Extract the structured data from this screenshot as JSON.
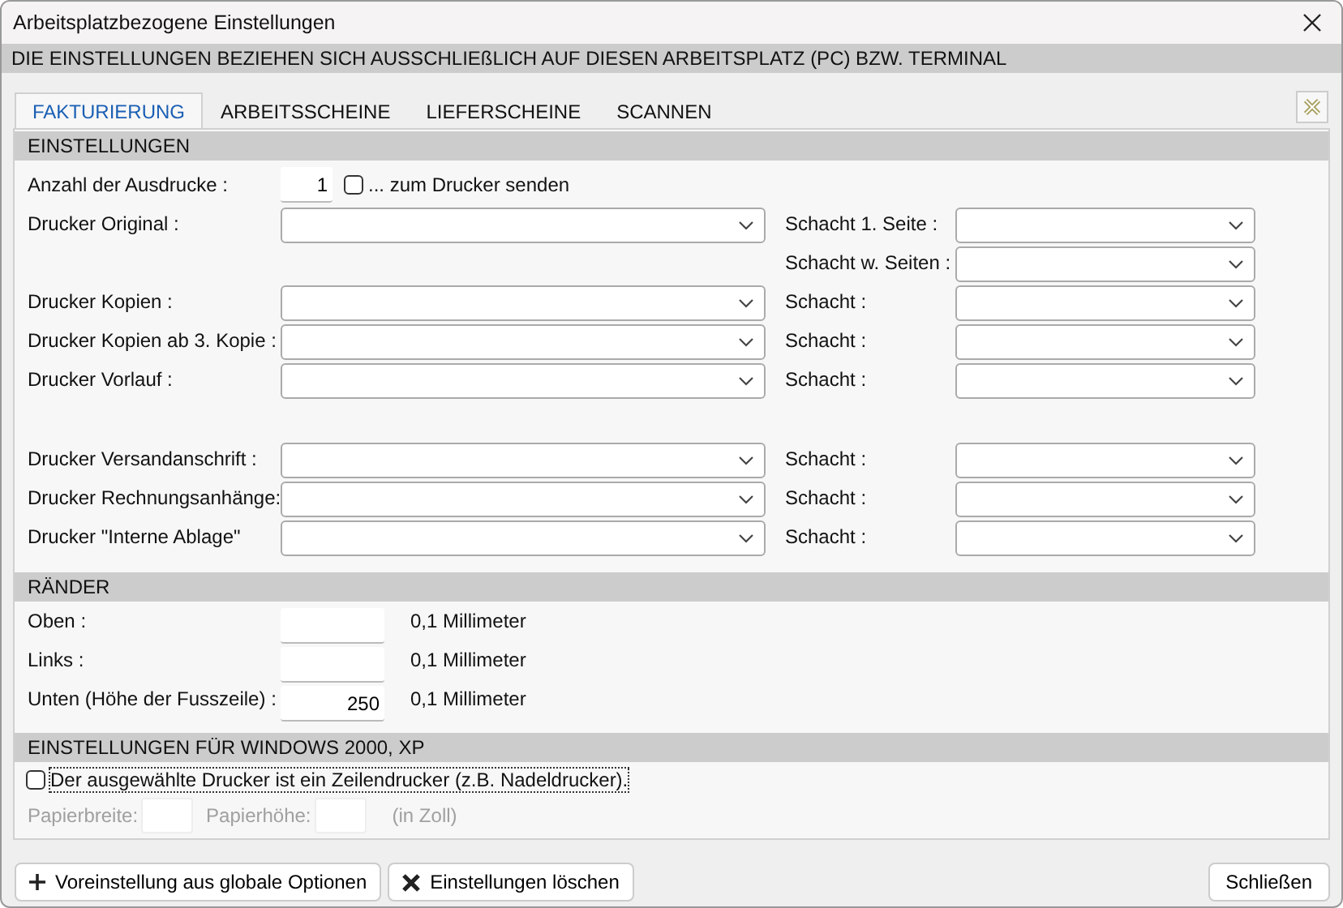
{
  "window": {
    "title": "Arbeitsplatzbezogene Einstellungen"
  },
  "banner": "DIE EINSTELLUNGEN BEZIEHEN SICH AUSSCHLIEßLICH AUF DIESEN ARBEITSPLATZ (PC) BZW. TERMINAL",
  "tabs": [
    {
      "label": "FAKTURIERUNG",
      "selected": true
    },
    {
      "label": "ARBEITSSCHEINE",
      "selected": false
    },
    {
      "label": "LIEFERSCHEINE",
      "selected": false
    },
    {
      "label": "SCANNEN",
      "selected": false
    }
  ],
  "settings": {
    "title": "EINSTELLUNGEN",
    "copies": {
      "label": "Anzahl der Ausdrucke :",
      "value": "1",
      "send_label": "... zum Drucker senden",
      "checked": false
    },
    "printer_groups": [
      [
        {
          "printer_label": "Drucker Original :",
          "tray_label": "Schacht 1. Seite :"
        },
        {
          "tray_label": "Schacht w. Seiten :"
        },
        {
          "printer_label": "Drucker Kopien :",
          "tray_label": "Schacht :"
        },
        {
          "printer_label": "Drucker Kopien ab 3. Kopie :",
          "tray_label": "Schacht :"
        },
        {
          "printer_label": "Drucker Vorlauf :",
          "tray_label": "Schacht :"
        }
      ],
      [
        {
          "printer_label": "Drucker Versandanschrift :",
          "tray_label": "Schacht :"
        },
        {
          "printer_label": "Drucker Rechnungsanhänge:",
          "tray_label": "Schacht :"
        },
        {
          "printer_label": "Drucker \"Interne Ablage\"",
          "tray_label": "Schacht :"
        }
      ]
    ]
  },
  "margins": {
    "title": "RÄNDER",
    "rows": [
      {
        "label": "Oben :",
        "unit": "0,1 Millimeter"
      },
      {
        "label": "Links :",
        "unit": "0,1 Millimeter"
      },
      {
        "label": "Unten (Höhe der Fusszeile) :",
        "value": "250",
        "unit": "0,1 Millimeter"
      }
    ]
  },
  "windows": {
    "title": "EINSTELLUNGEN FÜR WINDOWS 2000, XP",
    "line_printer": {
      "label": "Der ausgewählte Drucker ist ein Zeilendrucker (z.B. Nadeldrucker).",
      "checked": false
    },
    "paper": {
      "disabled": true,
      "width_label": "Papierbreite:",
      "height_label": "Papierhöhe:",
      "unit": "(in Zoll)"
    }
  },
  "buttons": [
    {
      "kind": "plus",
      "label": "Voreinstellung aus globale Optionen"
    },
    {
      "kind": "cross",
      "label": "Einstellungen löschen"
    },
    {
      "kind": "plain",
      "label": "Schließen"
    }
  ]
}
